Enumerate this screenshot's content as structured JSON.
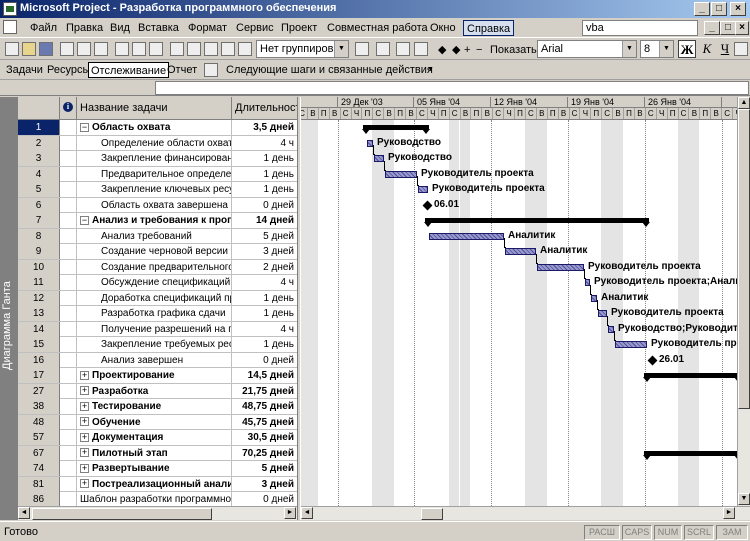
{
  "window": {
    "title": "Microsoft Project - Разработка программного обеспечения"
  },
  "menu": {
    "items": [
      "Файл",
      "Правка",
      "Вид",
      "Вставка",
      "Формат",
      "Сервис",
      "Проект",
      "Совместная работа",
      "Окно",
      "Справка"
    ],
    "search_value": "vba"
  },
  "toolbar": {
    "group_value": "Нет группировки",
    "show_label": "Показать",
    "font_value": "Arial",
    "size_value": "8",
    "bold": "Ж",
    "italic": "К",
    "underline": "Ч"
  },
  "guide": {
    "items": [
      "Задачи",
      "Ресурсы",
      "Отслеживание",
      "Отчет"
    ],
    "next_steps": "Следующие шаги и связанные действия"
  },
  "view_bar": {
    "label": "Диаграмма Ганта"
  },
  "sheet": {
    "columns": {
      "name": "Название задачи",
      "duration": "Длительность"
    },
    "rows": [
      {
        "id": "1",
        "name": "Область охвата",
        "duration": "3,5 дней",
        "summary": true,
        "exp": "−",
        "indent": 0
      },
      {
        "id": "2",
        "name": "Определение области охвата",
        "duration": "4 ч",
        "summary": false,
        "indent": 1
      },
      {
        "id": "3",
        "name": "Закрепление финансирования",
        "duration": "1 день",
        "summary": false,
        "indent": 1
      },
      {
        "id": "4",
        "name": "Предварительное определение",
        "duration": "1 день",
        "summary": false,
        "indent": 1
      },
      {
        "id": "5",
        "name": "Закрепление ключевых ресурсов",
        "duration": "1 день",
        "summary": false,
        "indent": 1
      },
      {
        "id": "6",
        "name": "Область охвата завершена",
        "duration": "0 дней",
        "summary": false,
        "indent": 1
      },
      {
        "id": "7",
        "name": "Анализ и требования к программе",
        "duration": "14 дней",
        "summary": true,
        "exp": "−",
        "indent": 0
      },
      {
        "id": "8",
        "name": "Анализ требований",
        "duration": "5 дней",
        "summary": false,
        "indent": 1
      },
      {
        "id": "9",
        "name": "Создание черновой версии спецификаций",
        "duration": "3 дней",
        "summary": false,
        "indent": 1
      },
      {
        "id": "10",
        "name": "Создание предварительного бюджета",
        "duration": "2 дней",
        "summary": false,
        "indent": 1
      },
      {
        "id": "11",
        "name": "Обсуждение спецификаций программы",
        "duration": "4 ч",
        "summary": false,
        "indent": 1
      },
      {
        "id": "12",
        "name": "Доработка спецификаций программы",
        "duration": "1 день",
        "summary": false,
        "indent": 1
      },
      {
        "id": "13",
        "name": "Разработка графика сдачи",
        "duration": "1 день",
        "summary": false,
        "indent": 1
      },
      {
        "id": "14",
        "name": "Получение разрешений на продолжение",
        "duration": "4 ч",
        "summary": false,
        "indent": 1
      },
      {
        "id": "15",
        "name": "Закрепление требуемых ресурсов",
        "duration": "1 день",
        "summary": false,
        "indent": 1
      },
      {
        "id": "16",
        "name": "Анализ завершен",
        "duration": "0 дней",
        "summary": false,
        "indent": 1
      },
      {
        "id": "17",
        "name": "Проектирование",
        "duration": "14,5 дней",
        "summary": true,
        "exp": "+",
        "indent": 0
      },
      {
        "id": "27",
        "name": "Разработка",
        "duration": "21,75 дней",
        "summary": true,
        "exp": "+",
        "indent": 0
      },
      {
        "id": "38",
        "name": "Тестирование",
        "duration": "48,75 дней",
        "summary": true,
        "exp": "+",
        "indent": 0
      },
      {
        "id": "48",
        "name": "Обучение",
        "duration": "45,75 дней",
        "summary": true,
        "exp": "+",
        "indent": 0
      },
      {
        "id": "57",
        "name": "Документация",
        "duration": "30,5 дней",
        "summary": true,
        "exp": "+",
        "indent": 0
      },
      {
        "id": "67",
        "name": "Пилотный этап",
        "duration": "70,25 дней",
        "summary": true,
        "exp": "+",
        "indent": 0
      },
      {
        "id": "74",
        "name": "Развертывание",
        "duration": "5 дней",
        "summary": true,
        "exp": "+",
        "indent": 0
      },
      {
        "id": "81",
        "name": "Постреализационный анализ",
        "duration": "3 дней",
        "summary": true,
        "exp": "+",
        "indent": 0
      },
      {
        "id": "86",
        "name": "Шаблон разработки программного обеспечения",
        "duration": "0 дней",
        "summary": false,
        "indent": 0
      }
    ]
  },
  "timescale": {
    "weeks": [
      "",
      "29 Дек '03",
      "05 Янв '04",
      "12 Янв '04",
      "19 Янв '04",
      "26 Янв '04",
      ""
    ],
    "day_letters": [
      "П",
      "В",
      "С",
      "Ч",
      "П",
      "С",
      "В"
    ]
  },
  "gantt": {
    "bar_labels": {
      "2": "Руководство",
      "3": "Руководство",
      "4": "Руководитель проекта",
      "5": "Руководитель проекта",
      "8": "Аналитик",
      "9": "Аналитик",
      "10": "Руководитель проекта",
      "11": "Руководитель проекта;Аналитик",
      "12": "Аналитик",
      "13": "Руководитель проекта",
      "14": "Руководство;Руководитель проекта",
      "15": "Руководитель проекта"
    },
    "milestones": {
      "6": "06.01",
      "16": "26.01"
    }
  },
  "status": {
    "text": "Готово",
    "indicators": [
      "РАСШ",
      "CAPS",
      "NUM",
      "SCRL",
      "ЗАМ"
    ]
  }
}
